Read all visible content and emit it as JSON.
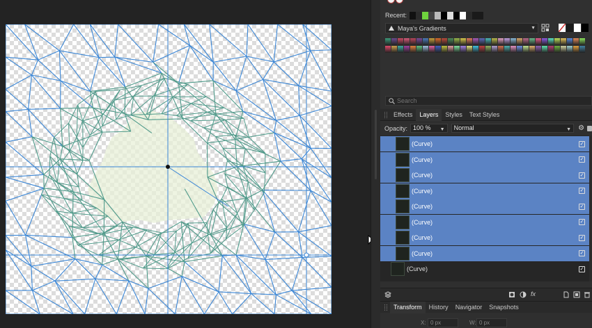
{
  "swatches": {
    "recent_label": "Recent:",
    "recent_colors": [
      "#111111",
      "#2b2b2b",
      "#6fd33d",
      "#444444",
      "#bbbbbb",
      "#000000",
      "#dddddd",
      "#000000",
      "#ffffff",
      "#2a2a2a"
    ],
    "palette_name": "Maya's Gradients",
    "fill_color": "#ffffff",
    "stroke_color": "#000000",
    "gradient_colors": [
      "#3d9a7a",
      "#6a4b8e",
      "#c94a63",
      "#d65a7a",
      "#b8455a",
      "#7a4a9a",
      "#4a7ab8",
      "#c9a03a",
      "#d86a2a",
      "#b84a3a",
      "#4a8a5a",
      "#9ab84a",
      "#d8c84a",
      "#e07a5a",
      "#a85ab8",
      "#5a6ab8",
      "#4ab8b8",
      "#b8b84a",
      "#e0a0c0",
      "#c0a0e0",
      "#8ab8d8",
      "#d8a86a",
      "#b86a8a",
      "#6ab88a",
      "#e05a8a",
      "#8a5ae0",
      "#5ae0c0",
      "#c0e05a",
      "#e0c05a",
      "#5a8ae0",
      "#e08a5a",
      "#8ae05a",
      "#e04a6a",
      "#d0a050",
      "#40a8a0",
      "#a040a0",
      "#e08040",
      "#60c080",
      "#a0c0e0",
      "#e060a0",
      "#4060c0",
      "#c0c040",
      "#e0a0a0",
      "#80e0a0",
      "#a080e0",
      "#e0e080",
      "#40c0e0",
      "#c04040",
      "#90b060",
      "#b0a0d0",
      "#d07050",
      "#50b0b0",
      "#e090c0",
      "#7090e0",
      "#c0e090",
      "#e0b070",
      "#9060b0",
      "#60e0b0",
      "#b04070",
      "#70b040",
      "#d0d0a0",
      "#a0d0d0",
      "#e0a040",
      "#4080a0"
    ]
  },
  "search": {
    "placeholder": "Search"
  },
  "tabs": [
    "Effects",
    "Layers",
    "Styles",
    "Text Styles"
  ],
  "active_tab": "Layers",
  "layer_props": {
    "opacity_label": "Opacity:",
    "opacity_value": "100 %",
    "blend_mode": "Normal"
  },
  "layers": [
    {
      "name": "(Curve)",
      "selected": true,
      "visible": true
    },
    {
      "name": "(Curve)",
      "selected": true,
      "visible": true
    },
    {
      "name": "(Curve)",
      "selected": true,
      "visible": true
    },
    {
      "name": "(Curve)",
      "selected": true,
      "visible": true
    },
    {
      "name": "(Curve)",
      "selected": true,
      "visible": true
    },
    {
      "name": "(Curve)",
      "selected": true,
      "visible": true
    },
    {
      "name": "(Curve)",
      "selected": true,
      "visible": true
    },
    {
      "name": "(Curve)",
      "selected": true,
      "visible": true
    },
    {
      "name": "(Curve)",
      "selected": false,
      "visible": true
    }
  ],
  "bottom_tabs": [
    "Transform",
    "History",
    "Navigator",
    "Snapshots"
  ],
  "active_bottom_tab": "Transform",
  "transform": {
    "x_label": "X:",
    "x_value": "0 px",
    "w_label": "W:",
    "w_value": "0 px"
  },
  "colors": {
    "mesh_stroke": "#3a86d6",
    "mesh_inner_stroke": "#4f9a8a",
    "center_fill": "#e8f0d8",
    "selection_blue": "#5b83c4"
  }
}
